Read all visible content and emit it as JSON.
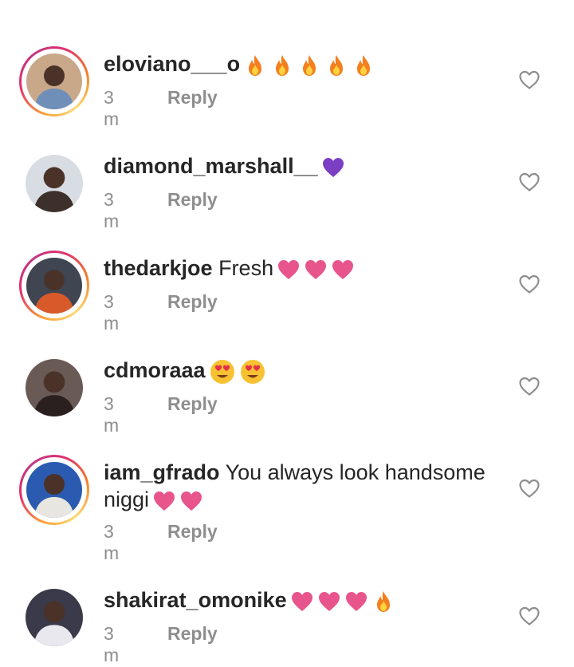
{
  "comments": [
    {
      "username": "eloviano___o",
      "text": "",
      "emoji": [
        "fire",
        "fire",
        "fire",
        "fire",
        "fire"
      ],
      "time": "3 m",
      "reply_label": "Reply",
      "has_story_ring": true,
      "avatar_colors": [
        "#c9a88a",
        "#6f8fb8"
      ]
    },
    {
      "username": "diamond_marshall__",
      "text": "",
      "emoji": [
        "purple-heart"
      ],
      "time": "3 m",
      "reply_label": "Reply",
      "has_story_ring": false,
      "avatar_colors": [
        "#d8dde4",
        "#3d2f2a"
      ]
    },
    {
      "username": "thedarkjoe",
      "text": "Fresh",
      "emoji": [
        "pink-heart",
        "pink-heart",
        "pink-heart"
      ],
      "time": "3 m",
      "reply_label": "Reply",
      "has_story_ring": true,
      "avatar_colors": [
        "#3f4652",
        "#d85a2a"
      ]
    },
    {
      "username": "cdmoraaa",
      "text": "",
      "emoji": [
        "heart-eyes",
        "heart-eyes"
      ],
      "time": "3 m",
      "reply_label": "Reply",
      "has_story_ring": false,
      "avatar_colors": [
        "#6a5a56",
        "#2a2020"
      ]
    },
    {
      "username": "iam_gfrado",
      "text": "You always look handsome",
      "text_line2": "niggi",
      "emoji": [
        "pink-heart",
        "pink-heart"
      ],
      "time": "3 m",
      "reply_label": "Reply",
      "has_story_ring": true,
      "avatar_colors": [
        "#2b5bb0",
        "#e8e6e0"
      ]
    },
    {
      "username": "shakirat_omonike",
      "text": "",
      "emoji": [
        "pink-heart",
        "pink-heart",
        "pink-heart",
        "fire"
      ],
      "time": "3 m",
      "reply_label": "Reply",
      "has_story_ring": false,
      "avatar_colors": [
        "#3a3a4a",
        "#e8e8ee"
      ]
    }
  ],
  "colors": {
    "username": "#262626",
    "meta": "#8e8e8e",
    "ring_start": "#f9a03a",
    "ring_end": "#e1306c",
    "pink_heart": "#e8548c",
    "purple_heart": "#7b3fc4",
    "fire": "#f47f1f",
    "heart_outline": "#8e8e8e"
  }
}
